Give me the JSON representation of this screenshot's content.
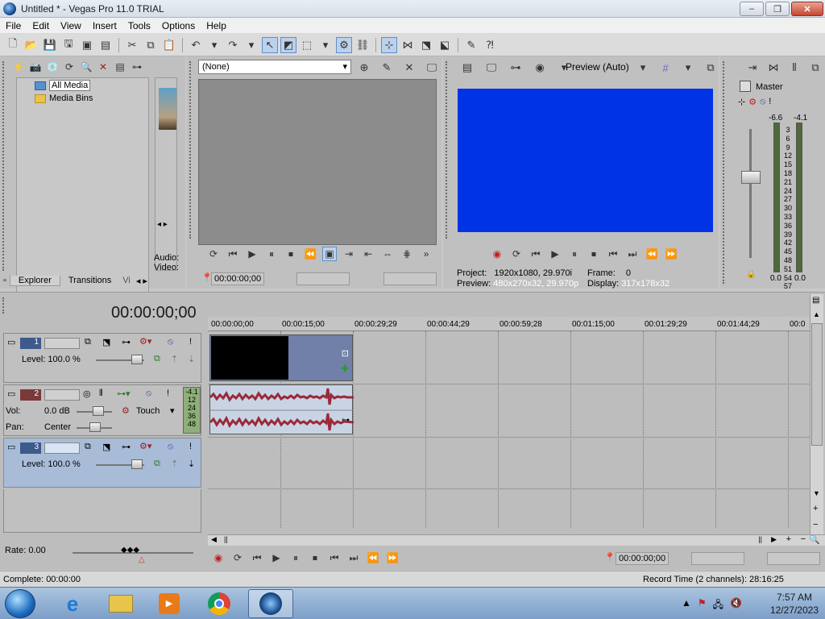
{
  "window": {
    "title": "Untitled * - Vegas Pro 11.0 TRIAL",
    "minimize": "‒",
    "maximize": "❐",
    "close": "✕"
  },
  "menu": [
    "File",
    "Edit",
    "View",
    "Insert",
    "Tools",
    "Options",
    "Help"
  ],
  "explorer": {
    "tree": [
      "All Media",
      "Media Bins"
    ],
    "side_labels": [
      "Audio:",
      "Video:"
    ],
    "tabs": [
      "Explorer",
      "Transitions",
      "Vi"
    ]
  },
  "trimmer": {
    "selection": "(None)",
    "timecode": "00:00:00;00"
  },
  "preview": {
    "mode": "Preview (Auto)",
    "project_label": "Project:",
    "project_value": "1920x1080, 29.970i",
    "preview_label": "Preview:",
    "preview_value": "480x270x32, 29.970p",
    "frame_label": "Frame:",
    "frame_value": "0",
    "display_label": "Display:",
    "display_value": "317x178x32",
    "screen_color": "#0033e6"
  },
  "master": {
    "title": "Master",
    "peak_left": "-6.6",
    "peak_right": "-4.1",
    "scale": [
      "3",
      "6",
      "9",
      "12",
      "15",
      "18",
      "21",
      "24",
      "27",
      "30",
      "33",
      "36",
      "39",
      "42",
      "45",
      "48",
      "51",
      "54",
      "57"
    ],
    "level_left": "0.0",
    "level_right": "0.0"
  },
  "timeline": {
    "cursor_time": "00:00:00;00",
    "ruler": [
      "00:00:00;00",
      "00:00:15;00",
      "00:00:29;29",
      "00:00:44;29",
      "00:00:59;28",
      "00:01:15;00",
      "00:01:29;29",
      "00:01:44;29",
      "00:0"
    ],
    "tracks": [
      {
        "number": "1",
        "type": "video",
        "level_label": "Level:",
        "level_value": "100.0 %"
      },
      {
        "number": "2",
        "type": "audio",
        "vol_label": "Vol:",
        "vol_value": "0.0 dB",
        "pan_label": "Pan:",
        "pan_value": "Center",
        "automation": "Touch",
        "meter_values": [
          "-4.1",
          "12",
          "24",
          "36",
          "48"
        ]
      },
      {
        "number": "3",
        "type": "video",
        "level_label": "Level:",
        "level_value": "100.0 %"
      }
    ],
    "rate": "Rate: 0.00",
    "transport_time": "00:00:00;00"
  },
  "status": {
    "complete": "Complete: 00:00:00",
    "record_time": "Record Time (2 channels): 28:16:25"
  },
  "taskbar": {
    "time": "7:57 AM",
    "date": "12/27/2023"
  }
}
